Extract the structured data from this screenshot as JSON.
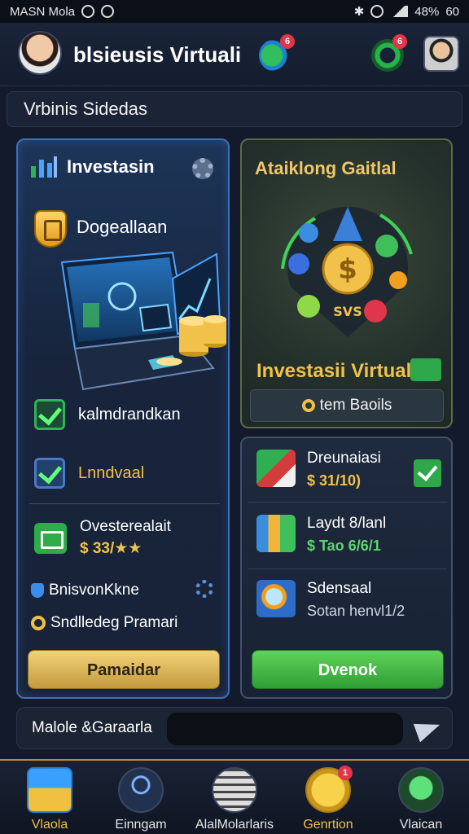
{
  "status_bar": {
    "carrier": "MASN Mola",
    "battery": "48%",
    "time": "60"
  },
  "header": {
    "title": "blsieusis Virtuali",
    "chat_badge": "6",
    "alert_badge": "6"
  },
  "search": {
    "label": "Vrbinis Sidedas"
  },
  "left_card": {
    "title": "Investasin",
    "dashboard_label": "Dogeallaan",
    "item1_label": "kalmdrandkan",
    "item2_label": "Lnndvaal",
    "item3_title": "Ovesterealait",
    "item3_value": "$ 33/★★",
    "footer1": "BnisvonKkne",
    "footer2": "Sndlledeg Pramari",
    "button": "Pamaidar"
  },
  "right_top_card": {
    "title": "Ataiklong Gaitlal",
    "subtitle": "Investasii Virtual",
    "details_button": "tem Baoils",
    "coin_label": "SVS"
  },
  "right_bottom_card": {
    "items": [
      {
        "title": "Dreunaiasi",
        "value": "$ 31/10)"
      },
      {
        "title": "Laydt 8/lanl",
        "value": "$ Tao 6/6/1"
      },
      {
        "title": "Sdensaal",
        "value": "Sotan henvl1/2"
      }
    ],
    "button": "Dvenok"
  },
  "message_bar": {
    "label": "Malole &Garaarla",
    "placeholder": ""
  },
  "bottom_nav": {
    "items": [
      {
        "label": "Vlaola"
      },
      {
        "label": "Einngam"
      },
      {
        "label": "AlalMolarlaris"
      },
      {
        "label": "Genrtion"
      },
      {
        "label": "Vlaican"
      }
    ],
    "badge": "1"
  },
  "colors": {
    "accent_gold": "#f2c14a",
    "accent_green": "#2fb358",
    "accent_blue": "#3f6fb8",
    "background": "#121a2b"
  }
}
